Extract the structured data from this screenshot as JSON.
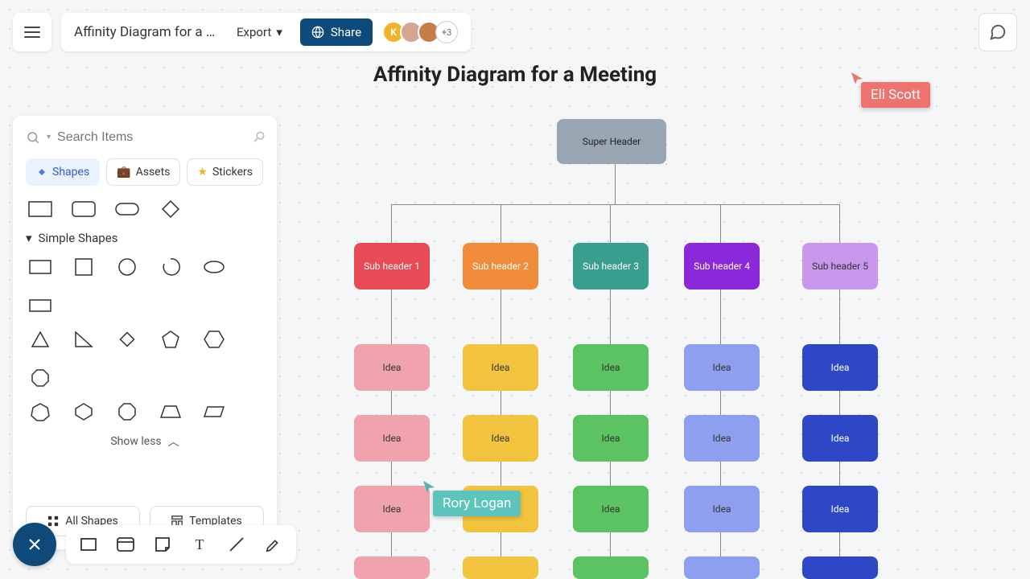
{
  "header": {
    "doc_title": "Affinity Diagram for a M...",
    "export_label": "Export",
    "share_label": "Share",
    "avatar_letter": "K",
    "avatar_more": "+3"
  },
  "sidebar": {
    "search_placeholder": "Search Items",
    "tabs": {
      "shapes": "Shapes",
      "assets": "Assets",
      "stickers": "Stickers"
    },
    "section_title": "Simple Shapes",
    "show_less": "Show less",
    "all_shapes": "All Shapes",
    "templates": "Templates"
  },
  "canvas": {
    "title": "Affinity Diagram for a Meeting",
    "super_header": "Super Header",
    "sub_headers": [
      "Sub header 1",
      "Sub header 2",
      "Sub header 3",
      "Sub header 4",
      "Sub header 5"
    ],
    "idea_label": "Idea",
    "colors": {
      "super": "#9aa7b3",
      "sub": [
        "#e84b55",
        "#f08c3a",
        "#3a9e8f",
        "#8b28d9",
        "#c896ea"
      ],
      "idea": [
        "#f0a3ad",
        "#f2c43e",
        "#5bc362",
        "#8f9ff0",
        "#2d47c7"
      ]
    }
  },
  "cursors": {
    "eli": "Eli Scott",
    "rory": "Rory Logan"
  }
}
